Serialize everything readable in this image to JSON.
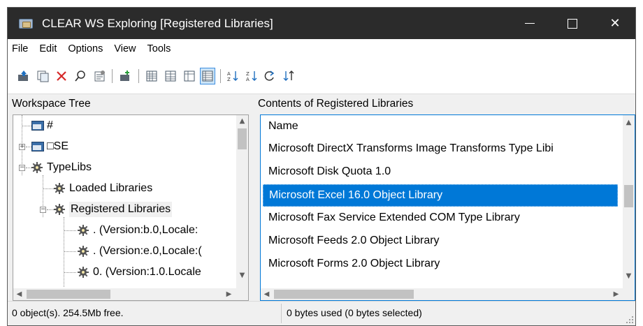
{
  "window": {
    "title": "CLEAR WS Exploring [Registered Libraries]"
  },
  "title_buttons": {
    "minimize_glyph": "—",
    "close_glyph": "✕"
  },
  "menu": [
    "File",
    "Edit",
    "Options",
    "View",
    "Tools"
  ],
  "toolbar": {
    "buttons": [
      "up-level",
      "copy-object",
      "delete",
      "find",
      "properties",
      "new-namespace",
      "large-icons-view",
      "small-icons-view",
      "list-view",
      "details-view",
      "sort-ascending",
      "sort-descending",
      "refresh",
      "sort-by-type"
    ],
    "pressed": "details-view",
    "delete_color": "#d62828"
  },
  "left_pane": {
    "header": "Workspace Tree",
    "nodes": [
      {
        "label": "#",
        "icon": "window-icon"
      },
      {
        "label": "□SE",
        "icon": "window-icon",
        "expander": "+"
      },
      {
        "label": "TypeLibs",
        "icon": "gear-icon",
        "expander": "−"
      },
      {
        "label": "Loaded Libraries",
        "icon": "gear-icon"
      },
      {
        "label": "Registered Libraries",
        "icon": "gear-icon",
        "expander": "−",
        "selected": true
      },
      {
        "label": ". (Version:b.0,Locale:",
        "icon": "gear-icon"
      },
      {
        "label": ". (Version:e.0,Locale:(",
        "icon": "gear-icon"
      },
      {
        "label": "0. (Version:1.0.Locale",
        "icon": "gear-icon"
      }
    ]
  },
  "right_pane": {
    "header": "Contents of Registered Libraries",
    "column": "Name",
    "rows": [
      {
        "name": "Microsoft DirectX Transforms Image Transforms Type Libi"
      },
      {
        "name": "Microsoft Disk Quota 1.0"
      },
      {
        "name": "Microsoft Excel 16.0 Object Library",
        "selected": true
      },
      {
        "name": "Microsoft Fax Service Extended COM Type Library"
      },
      {
        "name": "Microsoft Feeds 2.0 Object Library"
      },
      {
        "name": "Microsoft Forms 2.0 Object Library"
      }
    ],
    "selection_color": "#0078d7"
  },
  "status": {
    "left": "0 object(s). 254.5Mb free.",
    "right": "0 bytes used (0 bytes selected)"
  }
}
